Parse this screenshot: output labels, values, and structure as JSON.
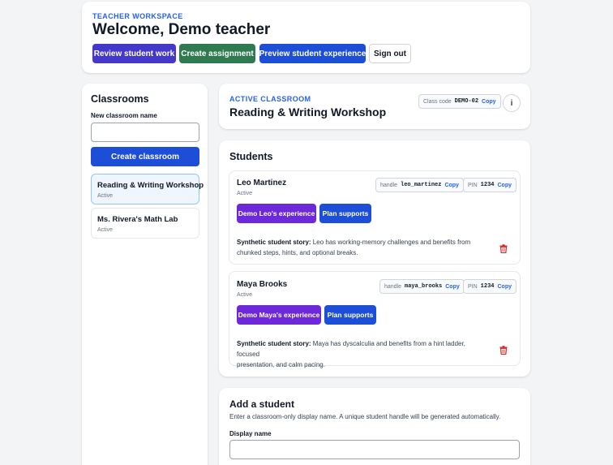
{
  "header": {
    "eyebrow": "TEACHER WORKSPACE",
    "title": "Welcome, Demo teacher",
    "buttons": {
      "review": "Review student work",
      "create_assignment": "Create assignment",
      "preview": "Preview student experience",
      "sign_out": "Sign out"
    }
  },
  "sidebar": {
    "title": "Classrooms",
    "new_label": "New classroom name",
    "new_value": "",
    "create_button": "Create classroom",
    "classrooms": [
      {
        "name": "Reading & Writing Workshop",
        "status": "Active"
      },
      {
        "name": "Ms. Rivera's Math Lab",
        "status": "Active"
      }
    ]
  },
  "active": {
    "eyebrow": "ACTIVE CLASSROOM",
    "title": "Reading & Writing Workshop",
    "class_code_label": "Class code",
    "class_code": "DEMO-02",
    "copy": "Copy",
    "info_icon": "i"
  },
  "students": {
    "title": "Students",
    "list": [
      {
        "name": "Leo Martinez",
        "status": "Active",
        "handle_label": "handle",
        "handle": "leo_martinez",
        "pin_label": "PIN",
        "pin": "1234",
        "copy": "Copy",
        "demo_button": "Demo Leo's experience",
        "plan_button": "Plan supports",
        "story_label": "Synthetic student story:",
        "story_line1": " Leo has working-memory challenges and benefits from",
        "story_line2": "chunked steps, hints, and optional breaks."
      },
      {
        "name": "Maya Brooks",
        "status": "Active",
        "handle_label": "handle",
        "handle": "maya_brooks",
        "pin_label": "PIN",
        "pin": "1234",
        "copy": "Copy",
        "demo_button": "Demo Maya's experience",
        "plan_button": "Plan supports",
        "story_label": "Synthetic student story:",
        "story_line1": " Maya has dyscalculia and benefits from a hint ladder, focused",
        "story_line2": "presentation, and calm pacing."
      }
    ]
  },
  "add_student": {
    "title": "Add a student",
    "description": "Enter a classroom-only display name. A unique student handle will be generated automatically.",
    "field_label": "Display name",
    "field_value": ""
  },
  "colors": {
    "primary_blue": "#1d4ed8",
    "indigo": "#4338ca",
    "green": "#2f7a4f",
    "purple": "#6d28d9",
    "danger": "#dc2626",
    "accent_text": "#2563eb"
  },
  "icons": {
    "trash": "trash-icon",
    "info": "info-icon"
  }
}
